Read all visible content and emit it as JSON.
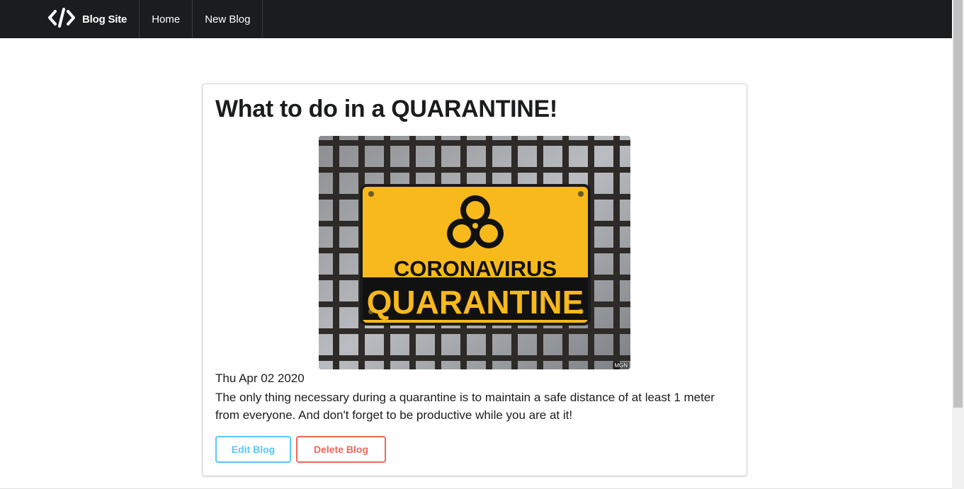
{
  "navbar": {
    "brand_icon": "code-brackets-icon",
    "brand_label": "Blog Site",
    "items": [
      {
        "label": "Home"
      },
      {
        "label": "New Blog"
      }
    ]
  },
  "post": {
    "title": "What to do in a QUARANTINE!",
    "image": {
      "sign_line1": "CORONAVIRUS",
      "sign_line2": "QUARANTINE",
      "watermark": "MGN",
      "symbol": "biohazard-icon"
    },
    "date": "Thu Apr 02 2020",
    "body": "The only thing necessary during a quarantine is to maintain a safe distance of at least 1 meter from everyone. And don't forget to be productive while you are at it!",
    "edit_label": "Edit Blog",
    "delete_label": "Delete Blog"
  },
  "colors": {
    "navbar_bg": "#1b1c1d",
    "edit_accent": "#54c8ff",
    "delete_accent": "#f0665a",
    "sign_yellow": "#f7b91c"
  }
}
